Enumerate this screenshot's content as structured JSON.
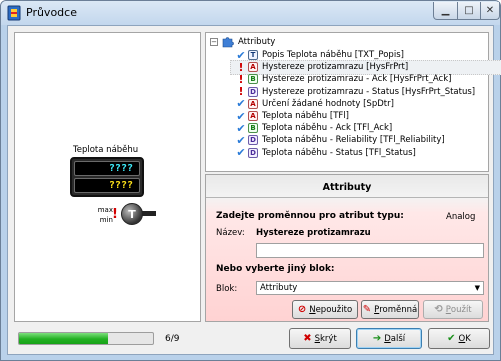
{
  "window": {
    "title": "Průvodce"
  },
  "device": {
    "label": "Teplota náběhu",
    "lcd_top": "????",
    "lcd_bottom": "????",
    "max_label": "max",
    "min_label": "min",
    "sensor_letter": "T"
  },
  "tree": {
    "root_label": "Attributy",
    "items": [
      {
        "status": "ok",
        "type": "T",
        "label": "Popis Teplota náběhu [TXT_Popis]"
      },
      {
        "status": "err",
        "type": "A",
        "label": "Hystereze protizamrazu [HysFrPrt]"
      },
      {
        "status": "err",
        "type": "B",
        "label": "Hystereze protizamrazu - Ack [HysFrPrt_Ack]"
      },
      {
        "status": "err",
        "type": "D",
        "label": "Hystereze protizamrazu - Status [HysFrPrt_Status]"
      },
      {
        "status": "ok",
        "type": "A",
        "label": "Určení žádané hodnoty [SpDtr]"
      },
      {
        "status": "ok",
        "type": "A",
        "label": "Teplota náběhu [TFl]"
      },
      {
        "status": "ok",
        "type": "B",
        "label": "Teplota náběhu - Ack [TFl_Ack]"
      },
      {
        "status": "ok",
        "type": "D",
        "label": "Teplota náběhu - Reliability [TFl_Reliability]"
      },
      {
        "status": "ok",
        "type": "D",
        "label": "Teplota náběhu - Status [TFl_Status]"
      }
    ]
  },
  "form": {
    "title": "Attributy",
    "prompt": "Zadejte proměnnou pro atribut typu:",
    "type_value": "Analog",
    "name_label": "Název:",
    "name_value": "Hystereze protizamrazu",
    "name_input_value": "",
    "or_label": "Nebo vyberte jiný blok:",
    "blok_label": "Blok:",
    "blok_selected": "Attributy",
    "btn_nepouzito_pre": "N",
    "btn_nepouzito_rest": "epoužito",
    "btn_promenna_pre": "P",
    "btn_promenna_rest": "roměnná",
    "btn_pouzit_pre": "P",
    "btn_pouzit_rest": "oužít"
  },
  "footer": {
    "progress_value": 0.6667,
    "progress_text": "6/9",
    "btn_skryt_pre": "S",
    "btn_skryt_rest": "krýt",
    "btn_dalsi_pre": "D",
    "btn_dalsi_rest": "alší",
    "btn_ok_pre": "O",
    "btn_ok_rest": "K"
  }
}
